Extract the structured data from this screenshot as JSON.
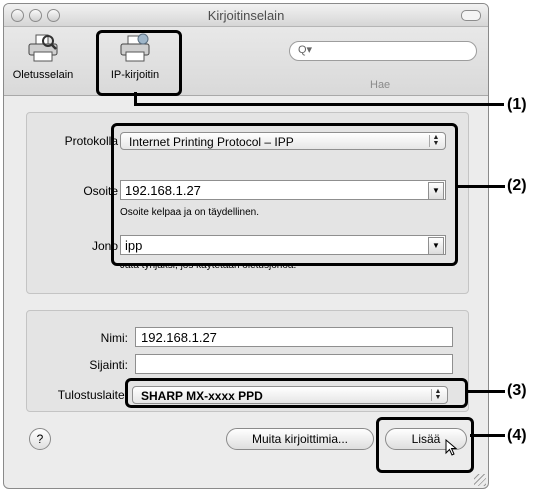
{
  "window": {
    "title": "Kirjoitinselain"
  },
  "toolbar": {
    "default_browser_label": "Oletusselain",
    "ip_printer_label": "IP-kirjoitin",
    "search_label": "Hae",
    "search_placeholder": ""
  },
  "connection": {
    "protocol_label": "Protokolla",
    "protocol_value": "Internet Printing Protocol – IPP",
    "address_label": "Osoite",
    "address_value": "192.168.1.27",
    "address_hint": "Osoite kelpaa ja on täydellinen.",
    "queue_label": "Jono",
    "queue_value": "ipp",
    "queue_hint": "Jätä tyhjäksi, jos käytetään oletusjonoa."
  },
  "printer": {
    "name_label": "Nimi:",
    "name_value": "192.168.1.27",
    "location_label": "Sijainti:",
    "location_value": "",
    "driver_label": "Tulostuslaite:",
    "driver_value": "SHARP MX-xxxx PPD"
  },
  "footer": {
    "help_label": "?",
    "more_printers_label": "Muita kirjoittimia...",
    "add_label": "Lisää"
  },
  "callouts": [
    "(1)",
    "(2)",
    "(3)",
    "(4)"
  ]
}
